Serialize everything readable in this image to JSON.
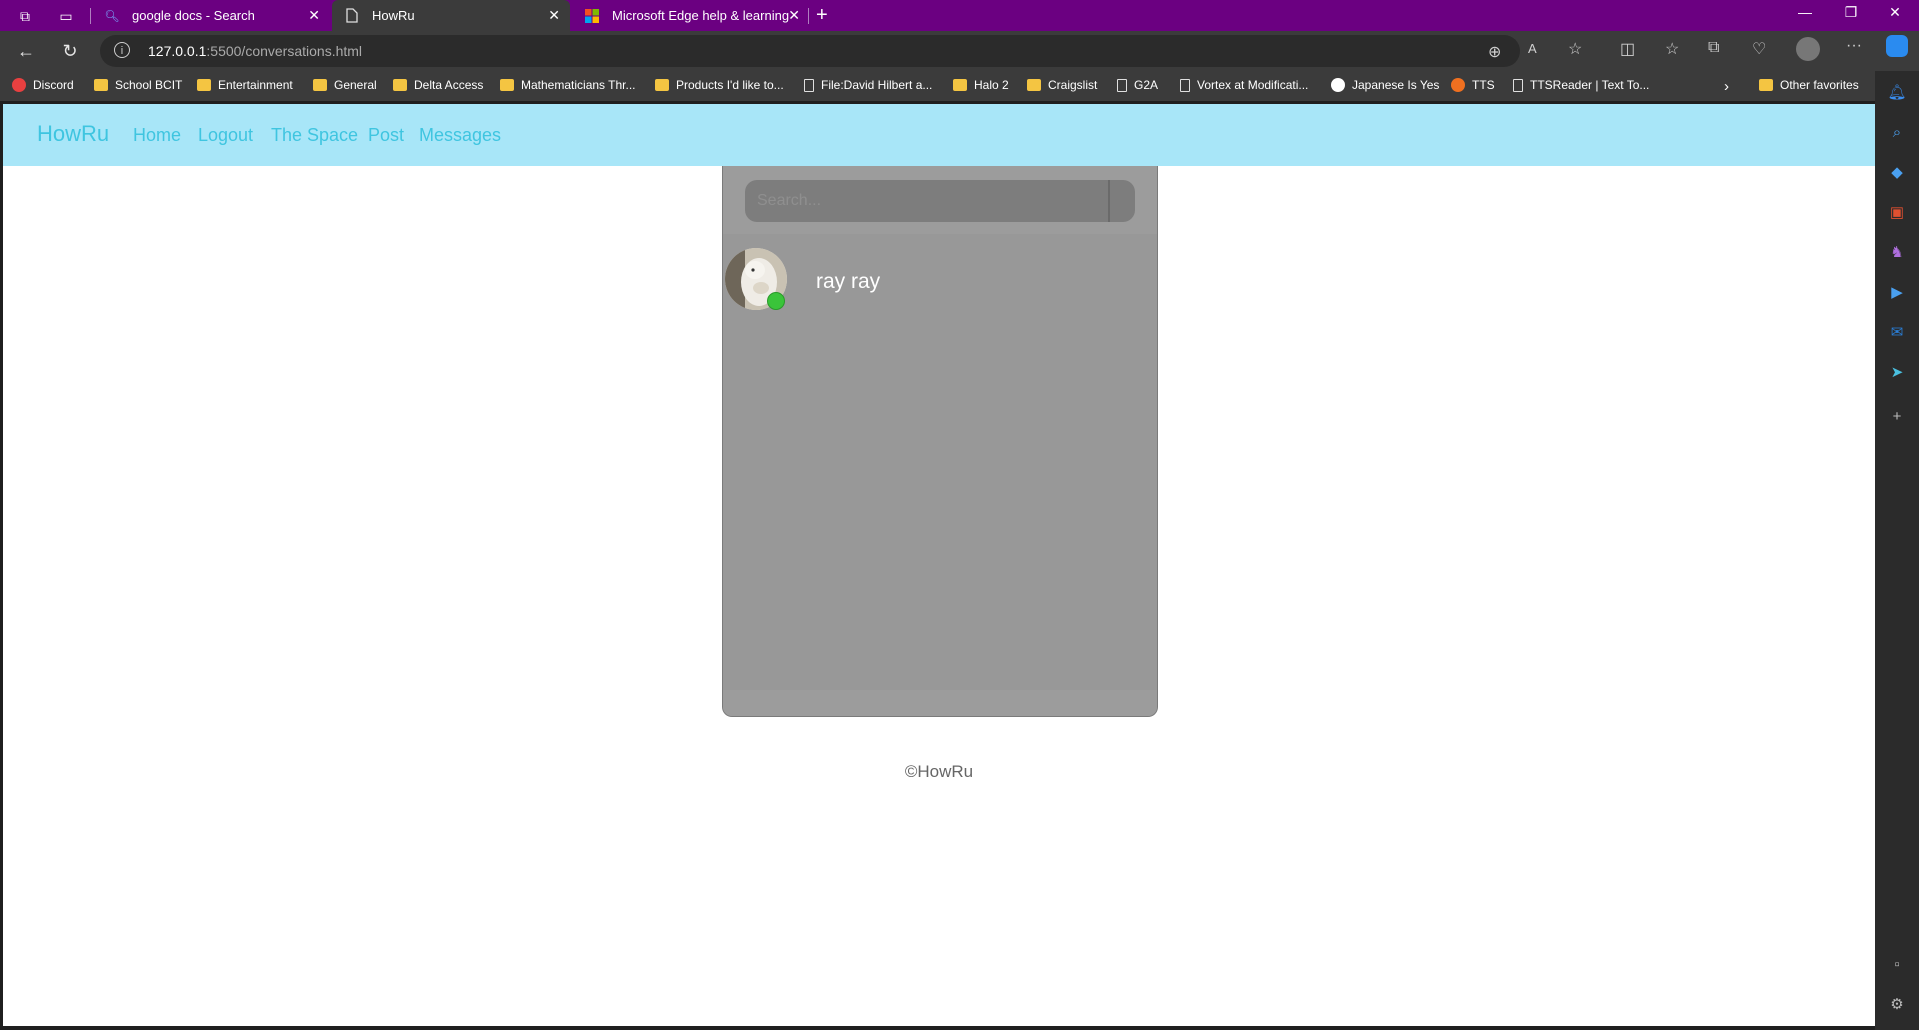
{
  "browser": {
    "tabs": [
      {
        "title": "google docs - Search",
        "favicon": "search-icon"
      },
      {
        "title": "HowRu",
        "favicon": "page-icon"
      },
      {
        "title": "Microsoft Edge help & learning",
        "favicon": "microsoft-logo-icon"
      }
    ],
    "address": {
      "host": "127.0.0.1",
      "path": ":5500/conversations.html"
    },
    "bookmarks": [
      {
        "label": "Discord",
        "icon": "discord-icon"
      },
      {
        "label": "School BCIT",
        "icon": "folder-icon"
      },
      {
        "label": "Entertainment",
        "icon": "folder-icon"
      },
      {
        "label": "General",
        "icon": "folder-icon"
      },
      {
        "label": "Delta Access",
        "icon": "folder-icon"
      },
      {
        "label": "Mathematicians Thr...",
        "icon": "folder-icon"
      },
      {
        "label": "Products I'd like to...",
        "icon": "folder-icon"
      },
      {
        "label": "File:David Hilbert a...",
        "icon": "page-icon"
      },
      {
        "label": "Halo 2",
        "icon": "folder-icon"
      },
      {
        "label": "Craigslist",
        "icon": "folder-icon"
      },
      {
        "label": "G2A",
        "icon": "page-icon"
      },
      {
        "label": "Vortex at Modificati...",
        "icon": "page-icon"
      },
      {
        "label": "Japanese Is Yes",
        "icon": "google-icon"
      },
      {
        "label": "TTS",
        "icon": "tts-icon"
      },
      {
        "label": "TTSReader | Text To...",
        "icon": "page-icon"
      }
    ],
    "other_favorites": "Other favorites"
  },
  "site": {
    "brand": "HowRu",
    "nav": [
      "Home",
      "Logout",
      "The Space",
      "Post",
      "Messages"
    ],
    "search_placeholder": "Search...",
    "conversations": [
      {
        "name": "ray ray",
        "status": "online"
      }
    ],
    "footer": "©HowRu"
  },
  "colors": {
    "titlebar": "#6b0081",
    "site_nav_bg": "#a8e6f8",
    "site_nav_text": "#3fc5e0",
    "panel_bg": "#989898",
    "online": "#3ac43a"
  }
}
